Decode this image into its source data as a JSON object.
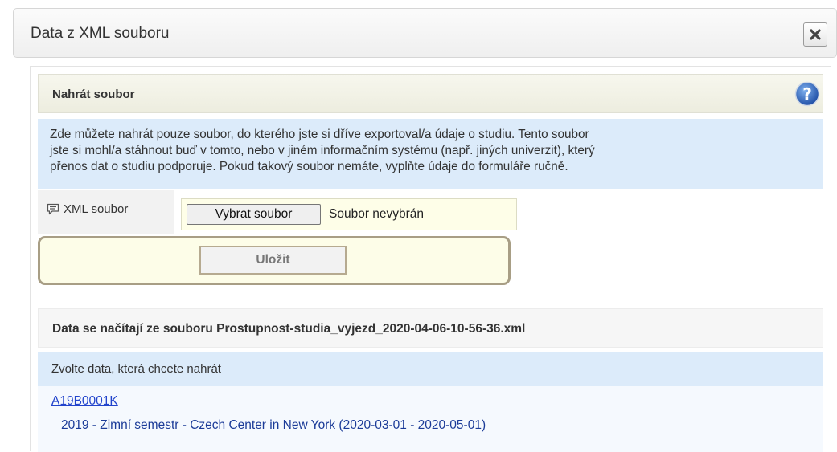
{
  "dialog": {
    "title": "Data z XML souboru",
    "close_icon": "close-icon"
  },
  "upload_section": {
    "title": "Nahrát soubor",
    "help_icon": "help-icon",
    "info_lines": [
      "Zde můžete nahrát pouze soubor, do kterého jste si dříve exportoval/a údaje o studiu. Tento soubor",
      "jste si mohl/a stáhnout buď v tomto, nebo v jiném informačním systému (např. jiných univerzit), který",
      "přenos dat o studiu podporuje. Pokud takový soubor nemáte, vyplňte údaje do formuláře ručně."
    ]
  },
  "file_field": {
    "label": "XML soubor",
    "label_icon": "comment-icon",
    "button_label": "Vybrat soubor",
    "status": "Soubor nevybrán"
  },
  "save_button": {
    "label": "Uložit"
  },
  "source": {
    "text": "Data se načítají ze souboru Prostupnost-studia_vyjezd_2020-04-06-10-56-36.xml"
  },
  "choose": {
    "text": "Zvolte data, která chcete nahrát"
  },
  "study": {
    "code": "A19B0001K",
    "detail": "2019 - Zimní semestr - Czech Center in New York (2020-03-01 - 2020-05-01)"
  },
  "colors": {
    "info_background": "#dcebfa",
    "link": "#2244cc",
    "help_icon": "#2e63b8"
  }
}
